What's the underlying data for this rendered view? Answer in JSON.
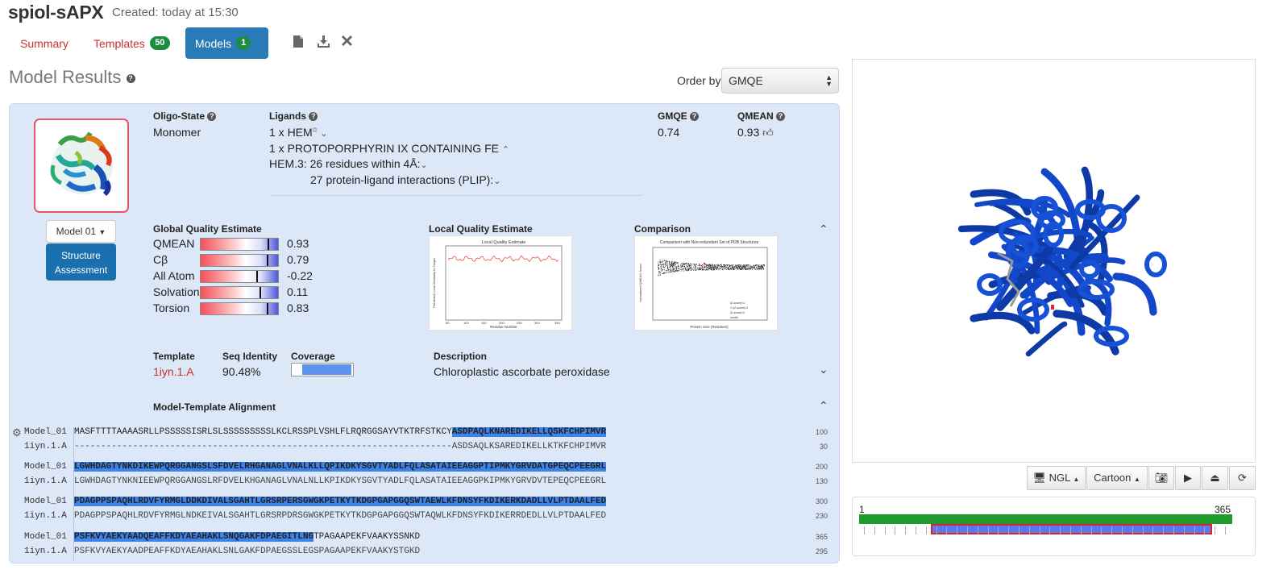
{
  "project": {
    "name": "spiol-sAPX",
    "created": "Created: today at 15:30"
  },
  "tabs": {
    "summary": "Summary",
    "templates": "Templates",
    "templates_count": "50",
    "models": "Models",
    "models_count": "1"
  },
  "toolbar_icons": [
    "file-icon",
    "download-icon",
    "close-icon"
  ],
  "results": {
    "title": "Model Results",
    "order_label": "Order by:",
    "order_value": "GMQE"
  },
  "model": {
    "dropdown": "Model 01",
    "structure_button_line1": "Structure",
    "structure_button_line2": "Assessment",
    "oligo_label": "Oligo-State",
    "oligo_value": "Monomer",
    "ligands_label": "Ligands",
    "ligand_1": "1 x HEM",
    "ligand_2": "1 x PROTOPORPHYRIN IX CONTAINING FE",
    "ligand_3_prefix": "HEM.3:",
    "ligand_3": "26 residues within 4Å:",
    "ligand_4": "27 protein-ligand interactions (PLIP):",
    "gmqe_label": "GMQE",
    "gmqe_value": "0.74",
    "qmean_label": "QMEAN",
    "qmean_value": "0.93"
  },
  "global_quality": {
    "title": "Global Quality Estimate",
    "rows": [
      {
        "name": "QMEAN",
        "value": "0.93",
        "position": 0.86
      },
      {
        "name": "Cβ",
        "value": "0.79",
        "position": 0.85
      },
      {
        "name": "All Atom",
        "value": "-0.22",
        "position": 0.72
      },
      {
        "name": "Solvation",
        "value": "0.11",
        "position": 0.76
      },
      {
        "name": "Torsion",
        "value": "0.83",
        "position": 0.85
      }
    ]
  },
  "local_quality": {
    "title": "Local Quality Estimate",
    "plot_title": "Local Quality Estimate",
    "xlabel": "Residue Number",
    "ylabel": "Predicted Local Similarity to Target"
  },
  "comparison": {
    "title": "Comparison",
    "plot_title": "Comparison with Non-redundant Set of PDB Structures",
    "xlabel": "Protein Size (Residues)",
    "ylabel": "Normalized QMEAN Score",
    "legend": [
      "|Z-score|<1",
      "1<|Z-score|<2",
      "|Z-score|>2",
      "model"
    ]
  },
  "template": {
    "template_label": "Template",
    "template_value": "1iyn.1.A",
    "seqid_label": "Seq Identity",
    "seqid_value": "90.48%",
    "coverage_label": "Coverage",
    "coverage_fraction": 0.78,
    "description_label": "Description",
    "description_value": "Chloroplastic ascorbate peroxidase"
  },
  "alignment": {
    "title": "Model-Template Alignment",
    "blocks": [
      {
        "model_name": "Model_01",
        "tpl_name": "1iyn.1.A",
        "model_plain": "MASFTTTTAAAASRLLPSSSSSISRLSLSSSSSSSSSLKCLRSSPLVSHLFLRQRGGSAYVTKTRFSTKCY",
        "model_hl": "ASDPAQLKNAREDIKELLQSKFCHPIMVR",
        "tpl_plain": "-----------------------------------------------------------------------",
        "tpl_hl": "ASDSAQLKSAREDIKELLKTKFCHPIMVR",
        "model_num": "100",
        "tpl_num": "30"
      },
      {
        "model_name": "Model_01",
        "tpl_name": "1iyn.1.A",
        "model_plain": "",
        "model_hl": "LGWHDAGTYNKDIKEWPQRGGANGSLSFDVELRHGANAGLVNALKLLQPIKDKYSGVTYADLFQLASATAIEEAGGPTIPMKYGRVDATGPEQCPEEGRL",
        "tpl_plain": "",
        "tpl_hl": "LGWHDAGTYNKNIEEWPQRGGANGSLRFDVELKHGANAGLVNALNLLKPIKDKYSGVTYADLFQLASATAIEEAGGPKIPMKYGRVDVTEPEQCPEEGRL",
        "model_num": "200",
        "tpl_num": "130"
      },
      {
        "model_name": "Model_01",
        "tpl_name": "1iyn.1.A",
        "model_plain": "",
        "model_hl": "PDAGPPSPAQHLRDVFYRMGLDDKDIVALSGAHTLGRSRPERSGWGKPETKYTKDGPGAPGGQSWTAEWLKFDNSYFKDIKERKDADLLVLPTDAALFED",
        "tpl_plain": "",
        "tpl_hl": "PDAGPPSPAQHLRDVFYRMGLNDKEIVALSGAHTLGRSRPDRSGWGKPETKYTKDGPGAPGGQSWTAQWLKFDNSYFKDIKERRDEDLLVLPTDAALFED",
        "model_num": "300",
        "tpl_num": "230"
      },
      {
        "model_name": "Model_01",
        "tpl_name": "1iyn.1.A",
        "model_hl": "PSFKVYAEKYAADQEAFFKDYAEAHAKLSNQGAKFDPAEGITLNG",
        "model_plain": "TPAGAAPEKFVAAKYSSNKD",
        "tpl_hl": "PSFKVYAEKYAADPEAFFKDYAEAHAKLSNLGAKFDPAEGSSLEGSPAGAAPEKFVAAKYSTGKD",
        "tpl_plain": "",
        "model_num": "365",
        "tpl_num": "295"
      }
    ]
  },
  "viewer": {
    "ngl": "NGL",
    "mode": "Cartoon",
    "seq_start": "1",
    "seq_end": "365"
  }
}
